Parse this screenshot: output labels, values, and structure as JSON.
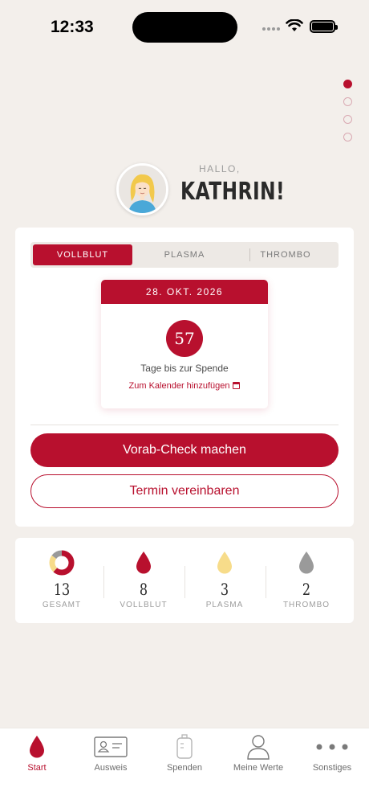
{
  "status_bar": {
    "time": "12:33"
  },
  "greeting": {
    "hello": "HALLO,",
    "name": "KATHRIN!"
  },
  "donation_types": {
    "tabs": [
      "VOLLBLUT",
      "PLASMA",
      "THROMBO"
    ],
    "active": "VOLLBLUT"
  },
  "next_donation": {
    "date": "28. OKT. 2026",
    "days": "57",
    "days_label": "Tage bis zur Spende",
    "calendar_link": "Zum Kalender hinzufügen"
  },
  "buttons": {
    "precheck": "Vorab-Check machen",
    "appointment": "Termin vereinbaren"
  },
  "stats": [
    {
      "value": "13",
      "label": "GESAMT",
      "icon": "donut-chart-icon"
    },
    {
      "value": "8",
      "label": "VOLLBLUT",
      "icon": "blood-drop-red-icon"
    },
    {
      "value": "3",
      "label": "PLASMA",
      "icon": "blood-drop-yellow-icon"
    },
    {
      "value": "2",
      "label": "THROMBO",
      "icon": "blood-drop-grey-icon"
    }
  ],
  "tabbar": [
    {
      "label": "Start",
      "icon": "drop-icon",
      "active": true
    },
    {
      "label": "Ausweis",
      "icon": "id-card-icon",
      "active": false
    },
    {
      "label": "Spenden",
      "icon": "blood-bag-icon",
      "active": false
    },
    {
      "label": "Meine Werte",
      "icon": "person-icon",
      "active": false
    },
    {
      "label": "Sonstiges",
      "icon": "more-icon",
      "active": false
    }
  ],
  "colors": {
    "accent": "#b8102e",
    "background": "#f3efeb",
    "plasma": "#f7dc8a",
    "thrombo": "#9a9a9a"
  }
}
